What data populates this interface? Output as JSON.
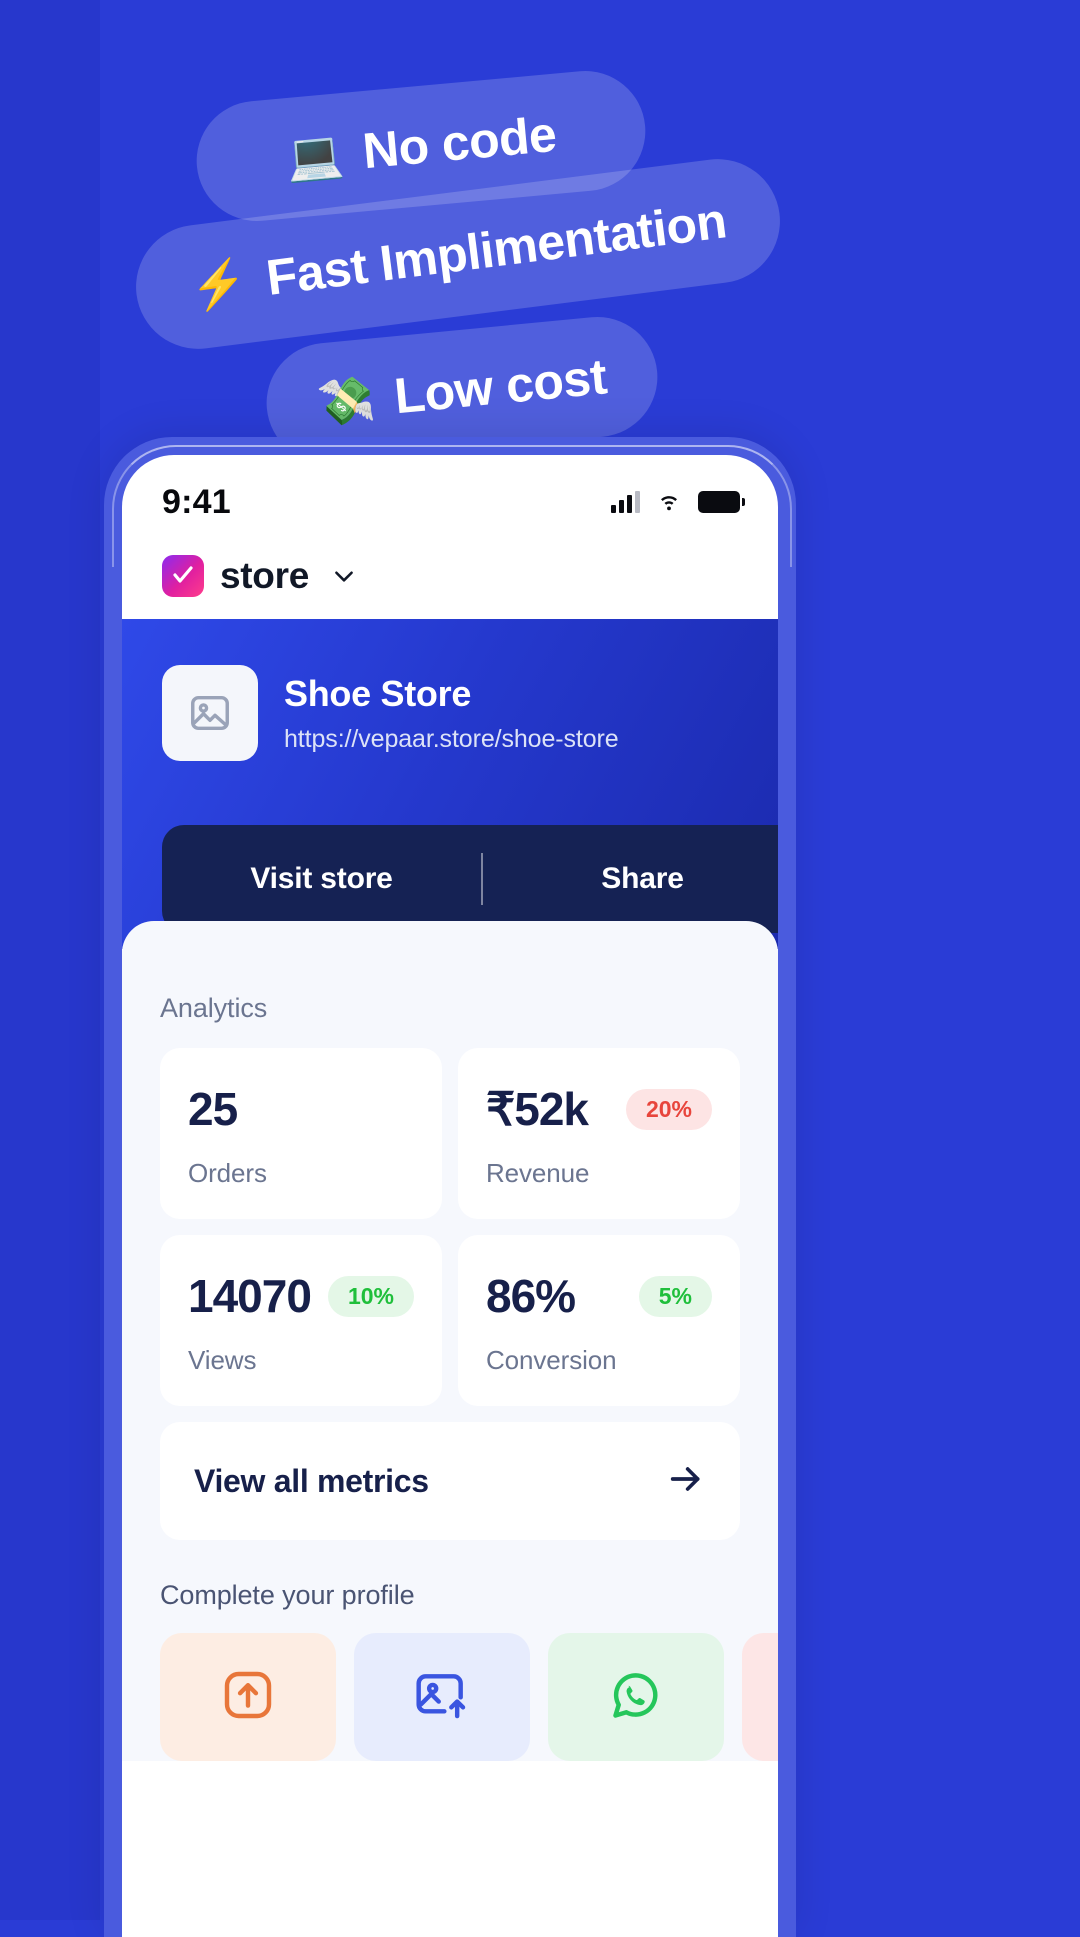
{
  "theme": {
    "background": "#2A3CD6",
    "rail": "#2737CC",
    "pill_fill": "rgba(255,255,255,0.18)",
    "phone_frame": "#4A5BDE",
    "hero_gradient_from": "#2F49E8",
    "hero_gradient_to": "#1B2AAE",
    "action_bar": "#152254",
    "sheet": "#F6F8FD",
    "value_color": "#17204A",
    "muted_color": "#6B7590",
    "badge_red_bg": "#FDE4E4",
    "badge_red_text": "#E8453C",
    "badge_green_bg": "#E4F7E7",
    "badge_green_text": "#1FBF3B"
  },
  "pills": [
    {
      "id": "no-code",
      "emoji": "💻",
      "icon": "laptop-emoji",
      "label": "No code"
    },
    {
      "id": "fast",
      "emoji": "⚡",
      "icon": "lightning-emoji",
      "label": "Fast Implimentation"
    },
    {
      "id": "low-cost",
      "emoji": "💸",
      "icon": "money-wings-emoji",
      "label": "Low cost"
    }
  ],
  "statusbar": {
    "time": "9:41",
    "signal_icon": "cellular-signal-icon",
    "wifi_icon": "wifi-icon",
    "battery_icon": "battery-full-icon"
  },
  "appbar": {
    "logo_icon": "vepaar-logo-icon",
    "title": "store",
    "chevron_icon": "chevron-down-icon"
  },
  "hero": {
    "thumb_icon": "image-placeholder-icon",
    "store_name": "Shoe Store",
    "store_url": "https://vepaar.store/shoe-store",
    "actions": [
      {
        "label": "Visit store"
      },
      {
        "label": "Share"
      }
    ]
  },
  "analytics": {
    "section_label": "Analytics",
    "cards": [
      {
        "value": "25",
        "label": "Orders",
        "badge": null,
        "badge_tone": null
      },
      {
        "value": "₹52k",
        "label": "Revenue",
        "badge": "20%",
        "badge_tone": "red"
      },
      {
        "value": "14070",
        "label": "Views",
        "badge": "10%",
        "badge_tone": "green"
      },
      {
        "value": "86%",
        "label": "Conversion",
        "badge": "5%",
        "badge_tone": "green"
      }
    ],
    "view_all": {
      "label": "View all metrics",
      "arrow_icon": "arrow-right-icon"
    }
  },
  "profile": {
    "section_label": "Complete your profile",
    "chips": [
      {
        "icon": "upload-box-icon",
        "tone": "orange"
      },
      {
        "icon": "image-upload-icon",
        "tone": "blue"
      },
      {
        "icon": "whatsapp-icon",
        "tone": "green"
      },
      {
        "icon": "partial-chip-icon",
        "tone": "red"
      }
    ]
  }
}
